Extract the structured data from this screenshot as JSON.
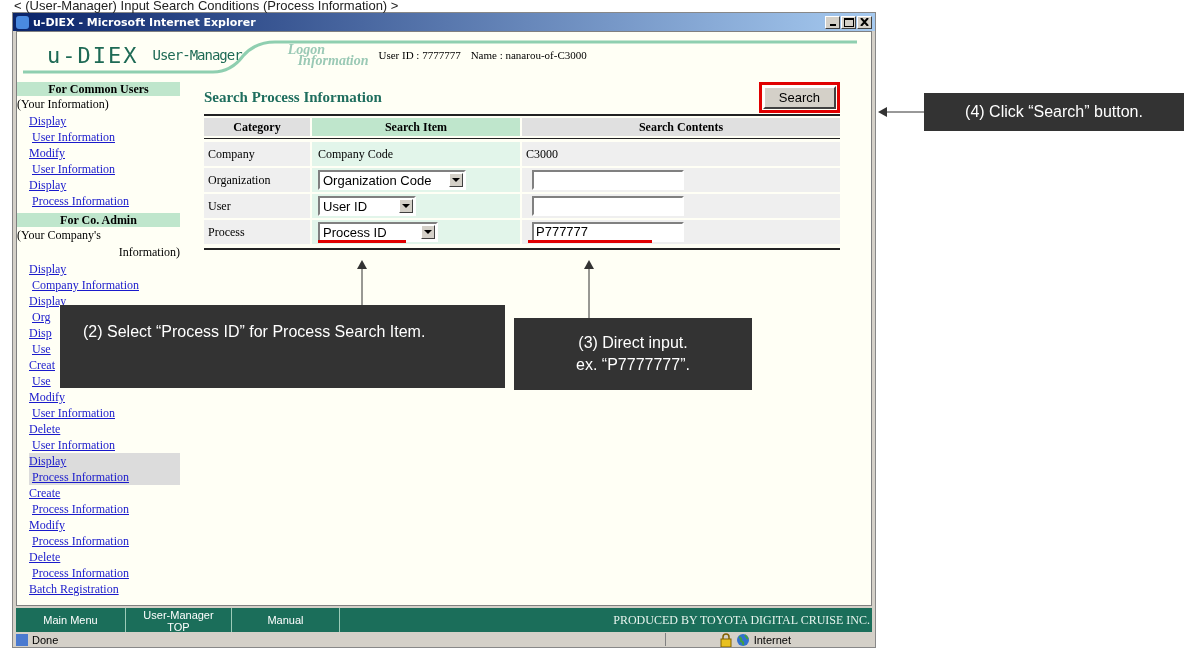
{
  "caption": "< (User-Manager) Input Search Conditions (Process Information) >",
  "window": {
    "title": "u-DIEX - Microsoft Internet Explorer"
  },
  "header": {
    "logo": "u-DIEX",
    "app": "User-Manager",
    "logon_label": [
      "Logon",
      "Information"
    ],
    "user_id": "User ID : 7777777",
    "name": "Name : nanarou-of-C3000"
  },
  "sidebar": {
    "sections": [
      {
        "heading": "For Common Users",
        "note": [
          "(Your Information)"
        ],
        "links": [
          {
            "action": "Display",
            "object": "User Information",
            "selected": false
          },
          {
            "action": "Modify",
            "object": "User Information",
            "selected": false
          },
          {
            "action": "Display",
            "object": "Process Information",
            "selected": false
          }
        ]
      },
      {
        "heading": "For Co. Admin",
        "note": [
          "(Your Company's",
          "Information)"
        ],
        "links": [
          {
            "action": "Display",
            "object": "Company Information",
            "selected": false
          },
          {
            "action": "Display",
            "object": "Org",
            "selected": false
          },
          {
            "action": "Disp",
            "object": "Use",
            "selected": false
          },
          {
            "action": "Creat",
            "object": "Use",
            "selected": false
          },
          {
            "action": "Modify",
            "object": "User Information",
            "selected": false
          },
          {
            "action": "Delete",
            "object": "User Information",
            "selected": false
          },
          {
            "action": "Display",
            "object": "Process Information",
            "selected": true
          },
          {
            "action": "Create",
            "object": "Process Information",
            "selected": false
          },
          {
            "action": "Modify",
            "object": "Process Information",
            "selected": false
          },
          {
            "action": "Delete",
            "object": "Process Information",
            "selected": false
          },
          {
            "action": "Batch Registration",
            "selected": false
          }
        ]
      }
    ]
  },
  "main": {
    "title": "Search Process Information",
    "search_button": {
      "label": "Search",
      "highlighted": true
    },
    "table": {
      "columns": [
        "Category",
        "Search Item",
        "Search Contents"
      ],
      "rows": [
        {
          "kind": "fixed",
          "category": "Company",
          "item": "Company Code",
          "value": "C3000",
          "marked": false
        },
        {
          "kind": "choice",
          "category": "Organization",
          "item": "Organization Code",
          "marked": false
        },
        {
          "kind": "choice",
          "category": "User",
          "item": "User ID",
          "marked": false
        },
        {
          "kind": "choice",
          "category": "Process",
          "item": "Process ID",
          "value": "P777777",
          "marked": true
        }
      ]
    }
  },
  "footer": {
    "buttons": [
      "Main Menu",
      "User-Manager TOP",
      "Manual"
    ],
    "credit": "PRODUCED BY TOYOTA DIGITAL CRUISE INC."
  },
  "status_bar": {
    "status": "Done",
    "zone": "Internet"
  },
  "callouts": [
    {
      "kind": "side",
      "lines": [
        "(4) Click “Search” button."
      ]
    },
    {
      "kind": "below",
      "lines": [
        "(2) Select “Process ID” for Process Search Item."
      ]
    },
    {
      "kind": "below",
      "lines": [
        "(3) Direct input.",
        "ex. “P7777777”."
      ]
    }
  ]
}
